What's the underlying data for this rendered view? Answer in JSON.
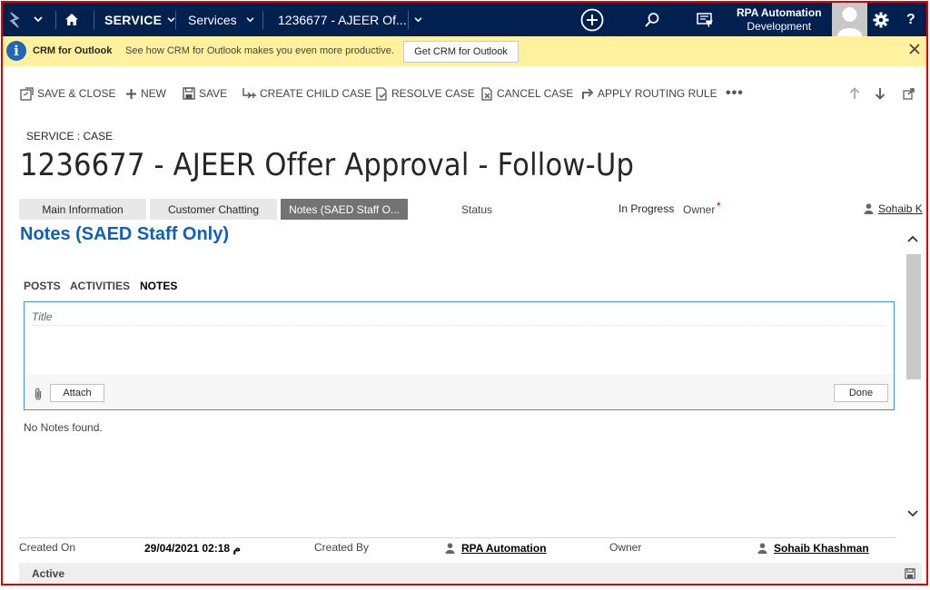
{
  "nav": {
    "module": "SERVICE",
    "area": "Services",
    "record": "1236677 - AJEER Of...",
    "org": "RPA Automation",
    "environment": "Development",
    "help": "?"
  },
  "notification": {
    "title": "CRM for Outlook",
    "message": "See how CRM for Outlook makes you even more productive.",
    "button": "Get CRM for Outlook"
  },
  "commands": {
    "save_close": "SAVE & CLOSE",
    "new": "NEW",
    "save": "SAVE",
    "create_child": "CREATE CHILD CASE",
    "resolve": "RESOLVE CASE",
    "cancel": "CANCEL CASE",
    "routing": "APPLY ROUTING RULE",
    "more": "•••"
  },
  "header": {
    "entity": "SERVICE : CASE",
    "title": "1236677 - AJEER Offer Approval - Follow-Up",
    "status_label": "Status",
    "status_value": "In Progress",
    "owner_label": "Owner",
    "owner_required": "*",
    "owner_value": "Sohaib K"
  },
  "tabs": [
    {
      "label": "Main Information"
    },
    {
      "label": "Customer Chatting"
    },
    {
      "label": "Notes (SAED Staff O..."
    }
  ],
  "section": {
    "title": "Notes (SAED Staff Only)",
    "pane_tabs": [
      "POSTS",
      "ACTIVITIES",
      "NOTES"
    ],
    "note_title_placeholder": "Title",
    "attach": "Attach",
    "done": "Done",
    "empty": "No Notes found."
  },
  "footer": {
    "created_on_label": "Created On",
    "created_on_value": "29/04/2021 02:18 م",
    "created_by_label": "Created By",
    "created_by_value": "RPA Automation",
    "owner_label": "Owner",
    "owner_value": "Sohaib Khashman",
    "state": "Active"
  },
  "colors": {
    "nav_bg": "#002050",
    "notify_bg": "#fff19d",
    "link_blue": "#1160b7",
    "active_tab": "#737373",
    "frame": "#e00000"
  }
}
